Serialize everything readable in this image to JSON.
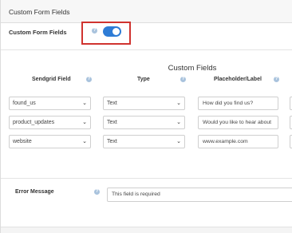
{
  "header": {
    "title": "Custom Form Fields"
  },
  "toggle_row": {
    "label": "Custom Form Fields",
    "enabled": true
  },
  "section": {
    "title": "Custom Fields"
  },
  "columns": {
    "sendgrid_field": "Sendgrid Field",
    "type": "Type",
    "placeholder": "Placeholder/Label"
  },
  "rows": [
    {
      "field": "found_us",
      "type": "Text",
      "placeholder": "How did you find us?"
    },
    {
      "field": "product_updates",
      "type": "Text",
      "placeholder": "Would you like to hear about"
    },
    {
      "field": "website",
      "type": "Text",
      "placeholder": "www.example.com"
    }
  ],
  "error": {
    "label": "Error Message",
    "value": "This field is required"
  },
  "icons": {
    "help": "question-circle-icon",
    "dropdown": "chevron-down-icon"
  },
  "colors": {
    "accent": "#2e7cd6",
    "highlight": "#d0332f",
    "help_icon": "#a9c3dd"
  }
}
